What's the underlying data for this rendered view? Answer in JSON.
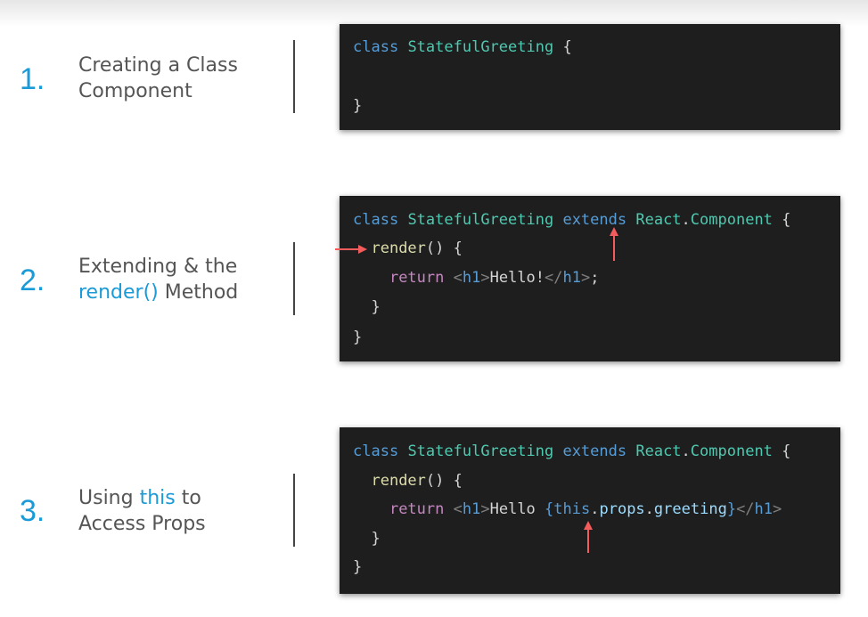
{
  "colors": {
    "accent": "#1a9ad6",
    "title_text": "#555555",
    "code_bg": "#1e1e1e",
    "arrow": "#f25c5c"
  },
  "steps": [
    {
      "number": "1.",
      "title_line1": "Creating a Class",
      "title_line2": "Component",
      "code": {
        "l1_kw": "class",
        "l1_name": "StatefulGreeting",
        "l1_brace": "{",
        "l2_brace": "}"
      }
    },
    {
      "number": "2.",
      "title_line1": "Extending & the",
      "title_hl": "render()",
      "title_line2_rest": " Method",
      "code": {
        "l1_kw": "class",
        "l1_name": "StatefulGreeting",
        "l1_extends": "extends",
        "l1_react": "React",
        "l1_dot": ".",
        "l1_component": "Component",
        "l1_brace": "{",
        "l2_fn": "render",
        "l2_rest": "() {",
        "l3_return": "return",
        "l3_open_lt": "<",
        "l3_open_tag": "h1",
        "l3_open_gt": ">",
        "l3_text": "Hello!",
        "l3_close_lt": "</",
        "l3_close_tag": "h1",
        "l3_close_gt": ">",
        "l3_semi": ";",
        "l4_brace": "}",
        "l5_brace": "}"
      }
    },
    {
      "number": "3.",
      "title_line1_a": "Using ",
      "title_hl": "this",
      "title_line1_b": " to",
      "title_line2": "Access Props",
      "code": {
        "l1_kw": "class",
        "l1_name": "StatefulGreeting",
        "l1_extends": "extends",
        "l1_react": "React",
        "l1_dot": ".",
        "l1_component": "Component",
        "l1_brace": "{",
        "l2_fn": "render",
        "l2_rest": "() {",
        "l3_return": "return",
        "l3_open_lt": "<",
        "l3_open_tag": "h1",
        "l3_open_gt": ">",
        "l3_text": "Hello ",
        "l3_lbrace": "{",
        "l3_this": "this",
        "l3_dot1": ".",
        "l3_props": "props",
        "l3_dot2": ".",
        "l3_greeting": "greeting",
        "l3_rbrace": "}",
        "l3_close_lt": "</",
        "l3_close_tag": "h1",
        "l3_close_gt": ">",
        "l4_brace": "}",
        "l5_brace": "}"
      }
    }
  ]
}
